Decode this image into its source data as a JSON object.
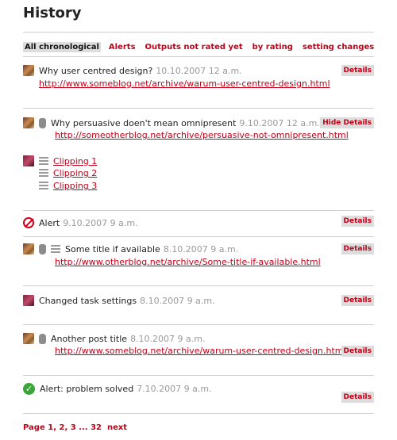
{
  "page_title": "History",
  "filters": [
    "All chronological",
    "Alerts",
    "Outputs not rated yet",
    "by rating",
    "setting changes"
  ],
  "entries": {
    "e1": {
      "title": "Why user centred design?",
      "date": "10.10.2007 12 a.m.",
      "url": "http://www.someblog.net/archive/warum-user-centred-design.html",
      "button": "Details"
    },
    "e2": {
      "title": "Why persuasive doen't mean omnipresent",
      "date": "9.10.2007 12 a.m.",
      "url": "http://someotherblog.net/archive/persuasive-not-omnipresent.html",
      "button": "Hide Details",
      "clippings": [
        "Clipping 1",
        "Clipping 2",
        "Clipping 3"
      ]
    },
    "e3": {
      "title": "Alert",
      "date": "9.10.2007 9 a.m.",
      "button": "Details"
    },
    "e4": {
      "title": "Some title if available",
      "date": "8.10.2007 9 a.m.",
      "url": "http://www.otherblog.net/archive/Some-title-if-available.html",
      "button": "Details"
    },
    "e5": {
      "title": "Changed task settings",
      "date": "8.10.2007 9 a.m.",
      "button": "Details"
    },
    "e6": {
      "title": "Another post title",
      "date": "8.10.2007 9 a.m.",
      "url": "http://www.someblog.net/archive/warum-user-centred-design.html",
      "button": "Details"
    },
    "e7": {
      "title": "Alert: problem solved",
      "date": "7.10.2007 9 a.m.",
      "button": "Details"
    }
  },
  "pagination": {
    "label": "Page",
    "pages": [
      "1,",
      "2,",
      "3 ...",
      "32"
    ],
    "next": "next"
  },
  "icons": [
    "user-avatar-icon",
    "thumb-icon",
    "text-lines-icon",
    "no-entry-icon",
    "check-circle-icon"
  ],
  "colors": {
    "link": "#c20017",
    "button_bg": "#dddddd",
    "alert": "#d0021b",
    "ok": "#3aa63a"
  }
}
